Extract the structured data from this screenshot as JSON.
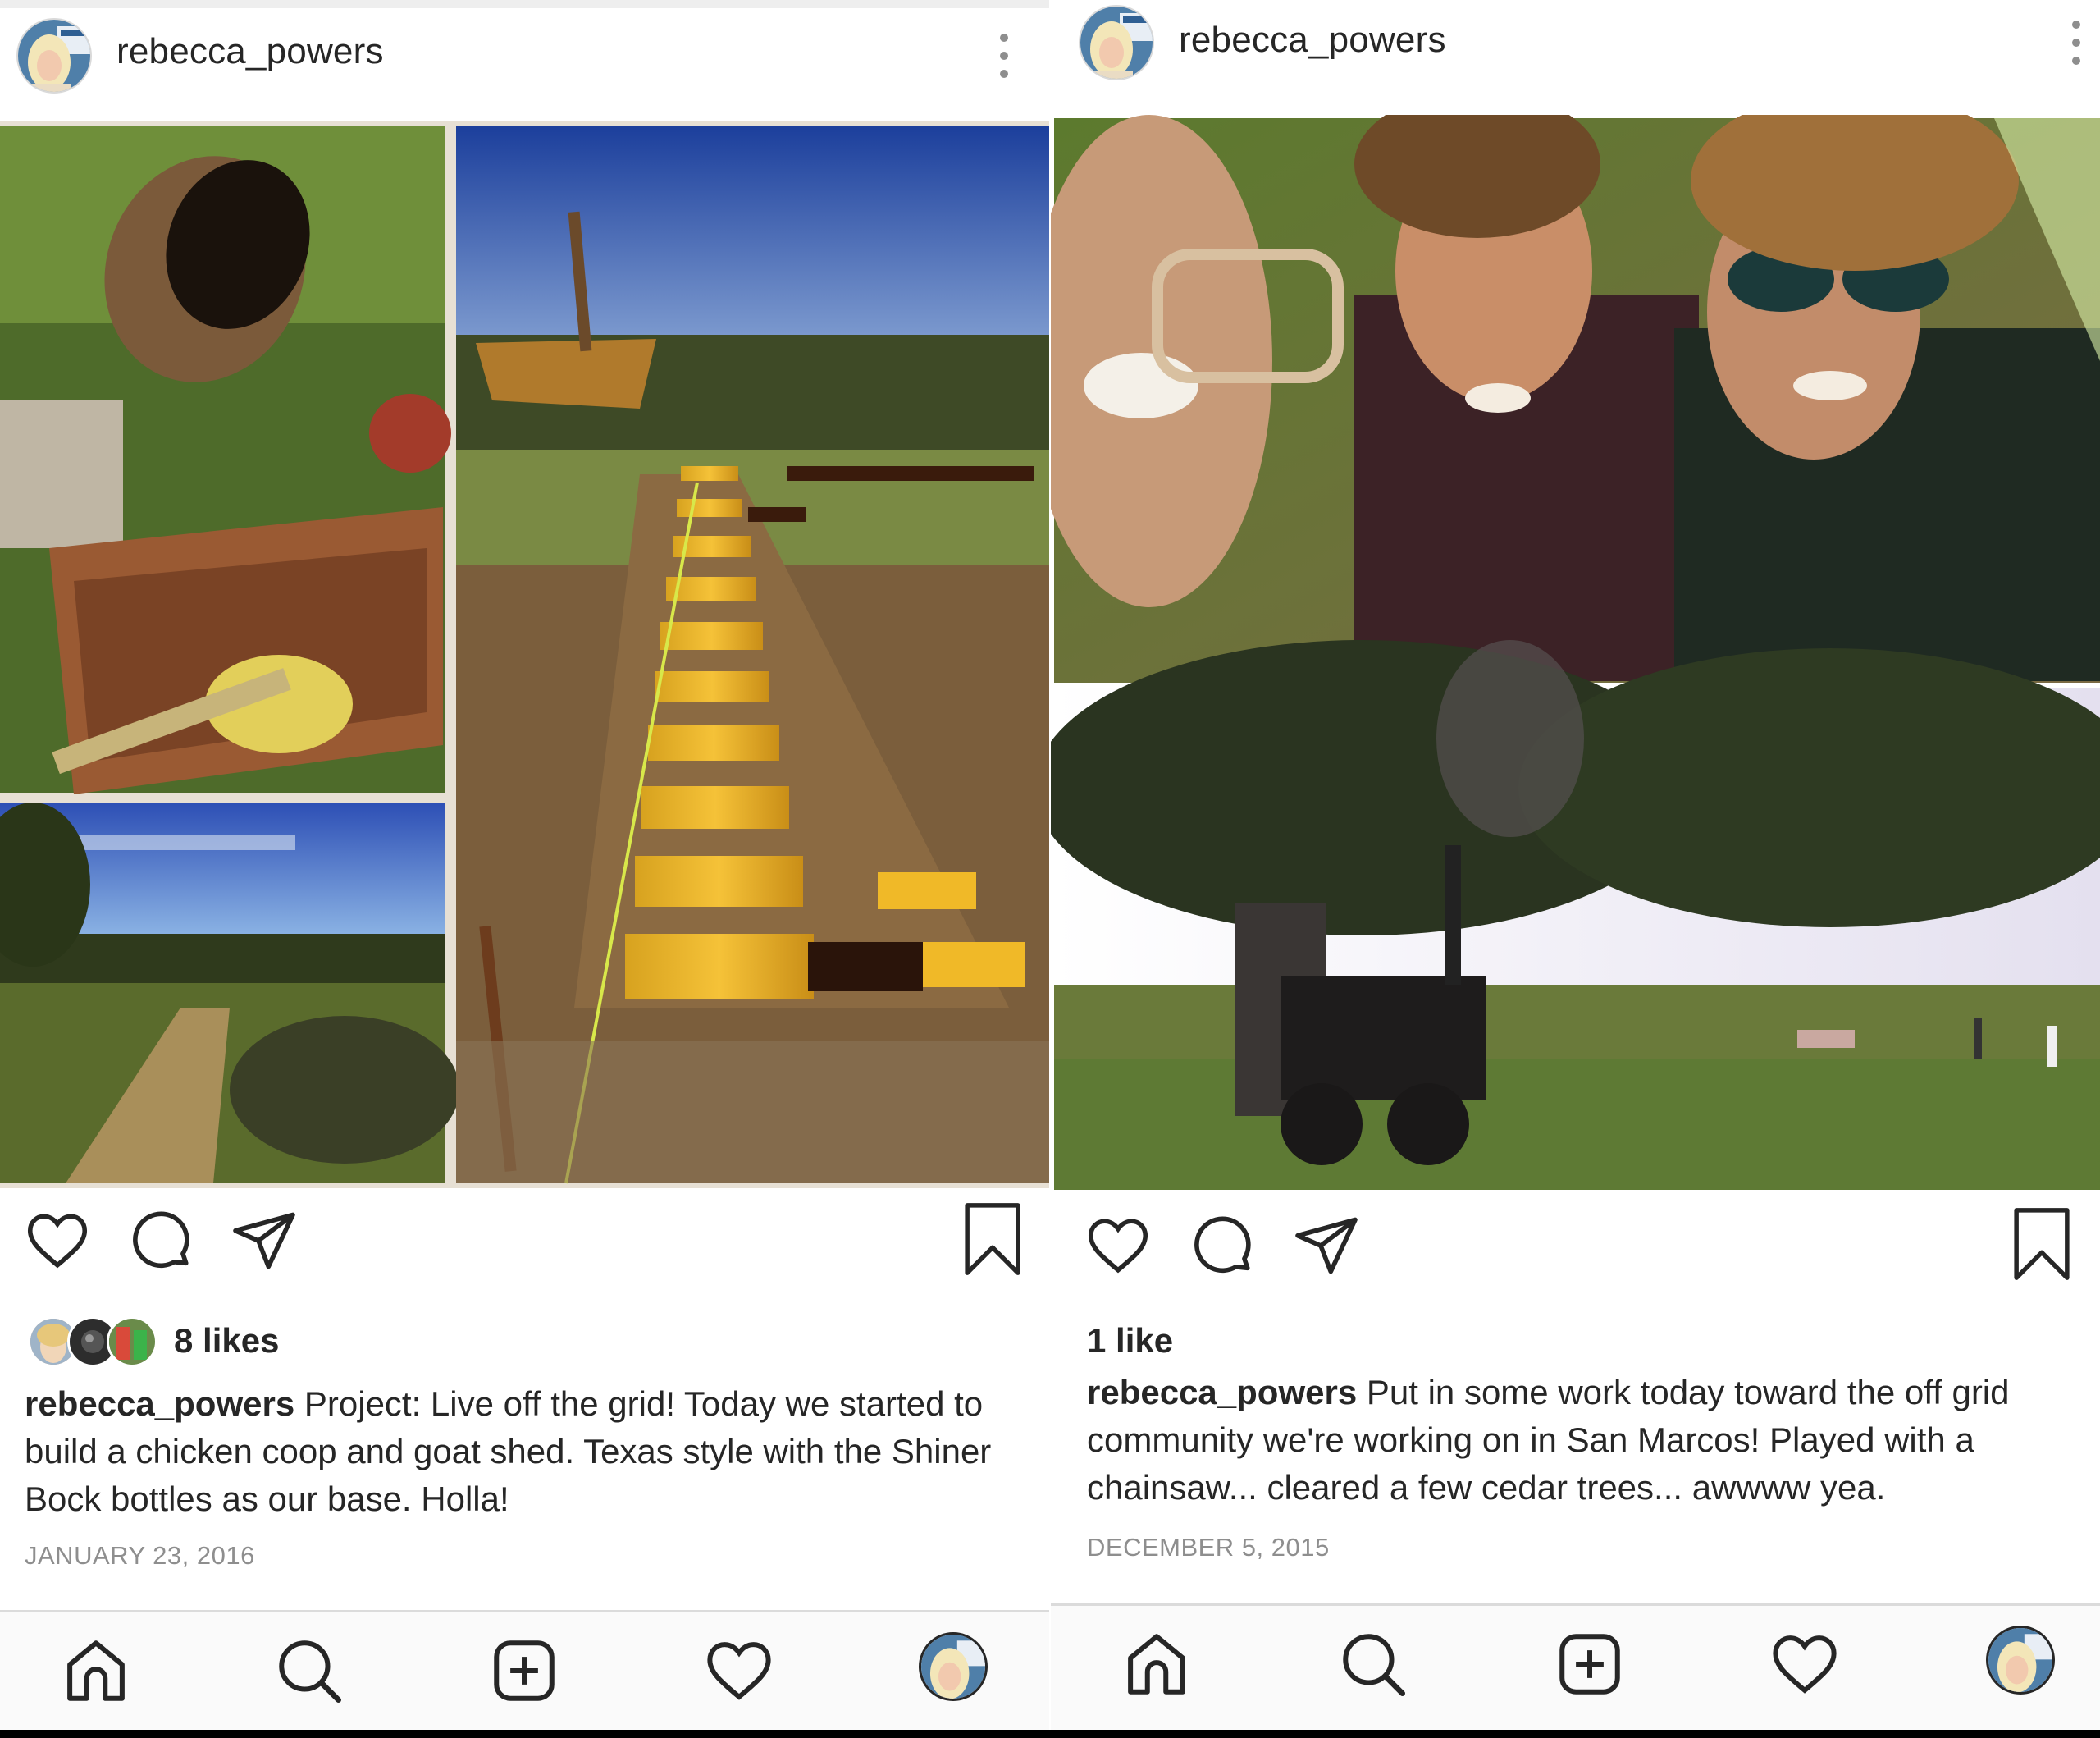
{
  "posts": [
    {
      "username": "rebecca_powers",
      "likes": "8 likes",
      "caption_user": "rebecca_powers",
      "caption_text": "Project: Live off the grid! Today we started to build a chicken coop and goat shed. Texas style with the Shiner Bock bottles as our base. Holla!",
      "date": "JANUARY 23, 2016"
    },
    {
      "username": "rebecca_powers",
      "likes": "1 like",
      "caption_user": "rebecca_powers",
      "caption_text": "Put in some work today toward the off grid community we're working on in San Marcos! Played with a chainsaw... cleared a few cedar trees... awwww yea.",
      "date": "DECEMBER 5, 2015"
    }
  ],
  "icons": {
    "actions": [
      "heart-icon",
      "comment-icon",
      "share-icon",
      "bookmark-icon"
    ],
    "nav": [
      "home-icon",
      "search-icon",
      "add-post-icon",
      "activity-heart-icon",
      "profile-avatar"
    ]
  },
  "colors": {
    "text": "#262626",
    "muted": "#8e8e8e",
    "background": "#ffffff",
    "navbar": "#fafafa"
  }
}
